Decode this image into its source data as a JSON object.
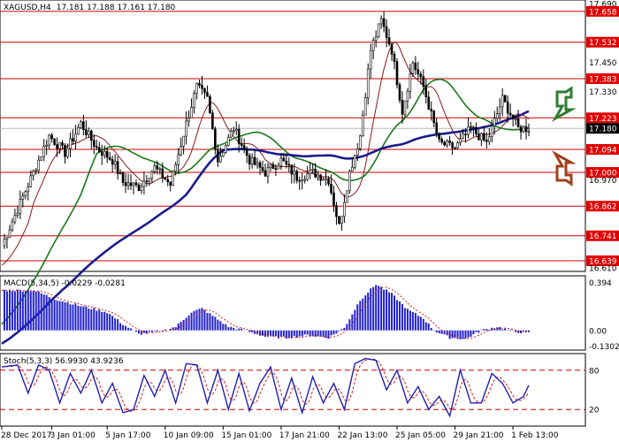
{
  "header": {
    "symbol": "XAGUSD,H4",
    "ohlc": "17.181 17.188 17.161 17.180"
  },
  "colors": {
    "background": "#ffffff",
    "candle": "#000000",
    "ma_fast": "#8b1a1a",
    "ma_mid": "#1a7a1a",
    "ma_slow": "#1c1c8c",
    "level_line": "#cc0000",
    "price_tag_red": "#e00000",
    "price_tag_current": "#000000",
    "macd_hist": "#2020d0",
    "macd_signal": "#cc2020",
    "stoch_main": "#2020b0",
    "stoch_signal": "#cc2020",
    "arrow_up": "#2e7d32",
    "arrow_down": "#a0401a"
  },
  "chart_data": [
    {
      "type": "candlestick",
      "title": "XAGUSD,H4",
      "ylim": [
        16.61,
        17.69
      ],
      "y_ticks": [
        {
          "value": 17.69,
          "label": "17.690",
          "tag": false
        },
        {
          "value": 17.658,
          "label": "17.658",
          "tag": true
        },
        {
          "value": 17.532,
          "label": "17.532",
          "tag": true
        },
        {
          "value": 17.45,
          "label": "17.450",
          "tag": false
        },
        {
          "value": 17.383,
          "label": "17.383",
          "tag": true
        },
        {
          "value": 17.33,
          "label": "17.330",
          "tag": false
        },
        {
          "value": 17.223,
          "label": "17.223",
          "tag": true
        },
        {
          "value": 17.18,
          "label": "17.180",
          "tag": "current"
        },
        {
          "value": 17.094,
          "label": "17.094",
          "tag": true
        },
        {
          "value": 17.0,
          "label": "17.000",
          "tag": true
        },
        {
          "value": 16.97,
          "label": "16.970",
          "tag": false
        },
        {
          "value": 16.862,
          "label": "16.862",
          "tag": true
        },
        {
          "value": 16.741,
          "label": "16.741",
          "tag": true
        },
        {
          "value": 16.639,
          "label": "16.639",
          "tag": true
        },
        {
          "value": 16.61,
          "label": "16.610",
          "tag": false
        }
      ],
      "levels": [
        17.658,
        17.532,
        17.383,
        17.223,
        17.094,
        17.0,
        16.862,
        16.741,
        16.639
      ],
      "close_anchors": [
        [
          0,
          16.7
        ],
        [
          6,
          16.85
        ],
        [
          12,
          17.0
        ],
        [
          18,
          17.15
        ],
        [
          24,
          17.08
        ],
        [
          30,
          17.2
        ],
        [
          36,
          17.1
        ],
        [
          42,
          17.05
        ],
        [
          46,
          16.96
        ],
        [
          52,
          16.94
        ],
        [
          58,
          17.02
        ],
        [
          64,
          16.95
        ],
        [
          70,
          17.2
        ],
        [
          74,
          17.35
        ],
        [
          78,
          17.3
        ],
        [
          82,
          17.05
        ],
        [
          88,
          17.18
        ],
        [
          94,
          17.05
        ],
        [
          100,
          17.0
        ],
        [
          106,
          17.05
        ],
        [
          112,
          16.98
        ],
        [
          118,
          17.0
        ],
        [
          124,
          16.97
        ],
        [
          128,
          16.78
        ],
        [
          132,
          17.0
        ],
        [
          136,
          17.15
        ],
        [
          140,
          17.5
        ],
        [
          144,
          17.62
        ],
        [
          148,
          17.5
        ],
        [
          152,
          17.25
        ],
        [
          156,
          17.45
        ],
        [
          160,
          17.35
        ],
        [
          166,
          17.12
        ],
        [
          172,
          17.1
        ],
        [
          178,
          17.18
        ],
        [
          184,
          17.12
        ],
        [
          190,
          17.3
        ],
        [
          196,
          17.18
        ],
        [
          200,
          17.18
        ]
      ],
      "moving_averages": [
        {
          "name": "fast",
          "start": 16.6,
          "end": 17.2
        },
        {
          "name": "mid",
          "start": 16.3,
          "end": 17.18
        },
        {
          "name": "slow",
          "start": 16.2,
          "end": 17.1
        }
      ]
    },
    {
      "type": "bar",
      "title": "MACD(5,34,5) -0.0229 -0.0281",
      "ylim": [
        -0.14,
        0.42
      ],
      "y_ticks": [
        {
          "value": 0.394,
          "label": "0.394"
        },
        {
          "value": 0.0,
          "label": "0.00"
        },
        {
          "value": -0.1302,
          "label": "-0.1302"
        }
      ],
      "hist_anchors": [
        [
          0,
          0.33
        ],
        [
          12,
          0.33
        ],
        [
          20,
          0.26
        ],
        [
          30,
          0.2
        ],
        [
          40,
          0.15
        ],
        [
          46,
          0.05
        ],
        [
          52,
          -0.03
        ],
        [
          60,
          -0.01
        ],
        [
          66,
          0.03
        ],
        [
          72,
          0.15
        ],
        [
          76,
          0.18
        ],
        [
          80,
          0.12
        ],
        [
          86,
          0.03
        ],
        [
          92,
          0.0
        ],
        [
          100,
          -0.05
        ],
        [
          108,
          -0.06
        ],
        [
          116,
          -0.04
        ],
        [
          124,
          -0.06
        ],
        [
          130,
          0.02
        ],
        [
          136,
          0.25
        ],
        [
          142,
          0.38
        ],
        [
          148,
          0.3
        ],
        [
          154,
          0.17
        ],
        [
          160,
          0.1
        ],
        [
          164,
          0.0
        ],
        [
          170,
          -0.06
        ],
        [
          176,
          -0.07
        ],
        [
          182,
          0.0
        ],
        [
          188,
          0.03
        ],
        [
          194,
          -0.01
        ],
        [
          200,
          -0.02
        ]
      ]
    },
    {
      "type": "line",
      "title": "Stoch(5,3,3) 56.9930 43.9236",
      "ylim": [
        0,
        100
      ],
      "levels": [
        80,
        20
      ],
      "y_ticks": [
        {
          "value": 80,
          "label": "80"
        },
        {
          "value": 20,
          "label": "20"
        }
      ],
      "stoch_anchors": [
        [
          0,
          85
        ],
        [
          6,
          88
        ],
        [
          10,
          45
        ],
        [
          14,
          88
        ],
        [
          18,
          80
        ],
        [
          22,
          30
        ],
        [
          26,
          75
        ],
        [
          30,
          45
        ],
        [
          34,
          80
        ],
        [
          38,
          30
        ],
        [
          42,
          60
        ],
        [
          46,
          15
        ],
        [
          50,
          20
        ],
        [
          54,
          72
        ],
        [
          58,
          40
        ],
        [
          62,
          80
        ],
        [
          66,
          30
        ],
        [
          70,
          90
        ],
        [
          74,
          88
        ],
        [
          78,
          30
        ],
        [
          82,
          80
        ],
        [
          86,
          20
        ],
        [
          90,
          75
        ],
        [
          94,
          18
        ],
        [
          98,
          60
        ],
        [
          102,
          85
        ],
        [
          106,
          20
        ],
        [
          110,
          68
        ],
        [
          114,
          15
        ],
        [
          118,
          70
        ],
        [
          122,
          30
        ],
        [
          126,
          60
        ],
        [
          130,
          20
        ],
        [
          134,
          90
        ],
        [
          138,
          98
        ],
        [
          142,
          95
        ],
        [
          146,
          50
        ],
        [
          150,
          80
        ],
        [
          154,
          30
        ],
        [
          158,
          55
        ],
        [
          162,
          20
        ],
        [
          166,
          40
        ],
        [
          170,
          10
        ],
        [
          174,
          80
        ],
        [
          178,
          30
        ],
        [
          182,
          30
        ],
        [
          186,
          75
        ],
        [
          190,
          60
        ],
        [
          194,
          30
        ],
        [
          198,
          40
        ],
        [
          200,
          57
        ]
      ]
    }
  ],
  "x_axis": {
    "labels": [
      {
        "bar": 0,
        "label": "28 Dec 2017"
      },
      {
        "bar": 19,
        "label": "3 Jan 01:00"
      },
      {
        "bar": 40,
        "label": "5 Jan 17:00"
      },
      {
        "bar": 62,
        "label": "10 Jan 09:00"
      },
      {
        "bar": 84,
        "label": "15 Jan 01:00"
      },
      {
        "bar": 106,
        "label": "17 Jan 21:00"
      },
      {
        "bar": 128,
        "label": "22 Jan 13:00"
      },
      {
        "bar": 150,
        "label": "25 Jan 05:00"
      },
      {
        "bar": 172,
        "label": "29 Jan 21:00"
      },
      {
        "bar": 194,
        "label": "1 Feb 13:00"
      }
    ]
  },
  "arrows": [
    {
      "direction": "up",
      "icon": "up-arrow-icon"
    },
    {
      "direction": "down",
      "icon": "down-arrow-icon"
    }
  ]
}
